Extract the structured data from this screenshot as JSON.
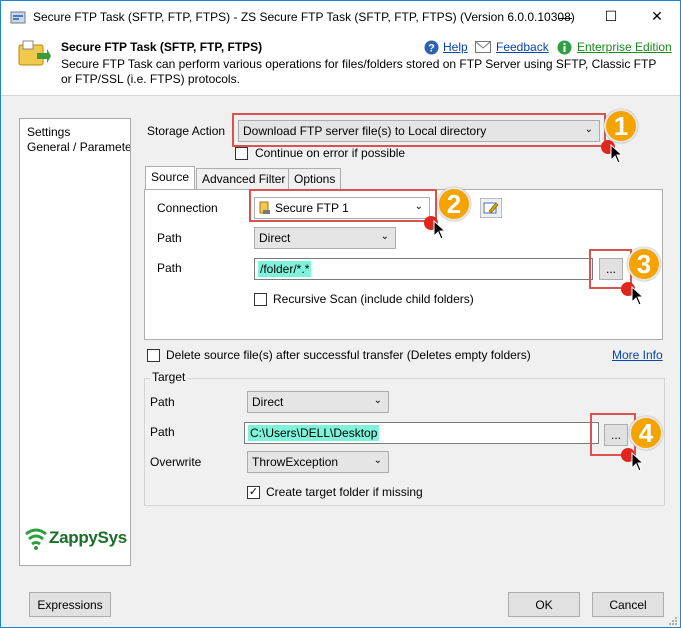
{
  "window": {
    "title": "Secure FTP Task (SFTP, FTP, FTPS) - ZS Secure FTP Task (SFTP, FTP, FTPS) (Version 6.0.0.10308)",
    "minimize": "—",
    "maximize": "☐",
    "close": "✕"
  },
  "header": {
    "title": "Secure FTP Task (SFTP, FTP, FTPS)",
    "description": "Secure FTP Task can perform various operations for files/folders stored on FTP Server using SFTP, Classic FTP or FTP/SSL (i.e. FTPS) protocols.",
    "help": "Help",
    "feedback": "Feedback",
    "edition": "Enterprise Edition"
  },
  "sidebar": {
    "items": [
      "Settings",
      "General / Parameters"
    ],
    "logo_text": "ZappySys"
  },
  "storage": {
    "label": "Storage Action",
    "value": "Download FTP server file(s) to Local directory",
    "continue_on_error": "Continue on error if possible"
  },
  "tabs": [
    "Source",
    "Advanced Filter",
    "Options"
  ],
  "source": {
    "connection_label": "Connection",
    "connection_value": "Secure FTP 1",
    "path_type_label": "Path",
    "path_type_value": "Direct",
    "path_label": "Path",
    "path_value": "/folder/*.*",
    "browse": "...",
    "recursive": "Recursive Scan (include child folders)"
  },
  "delete_source": "Delete source file(s) after successful transfer (Deletes empty folders)",
  "more_info": "More Info",
  "target": {
    "group_label": "Target",
    "path_type_label": "Path",
    "path_type_value": "Direct",
    "path_label": "Path",
    "path_value": "C:\\Users\\DELL\\Desktop",
    "browse": "...",
    "overwrite_label": "Overwrite",
    "overwrite_value": "ThrowException",
    "create_folder": "Create target folder if missing",
    "create_folder_checked": "✓"
  },
  "footer": {
    "expressions": "Expressions",
    "ok": "OK",
    "cancel": "Cancel"
  },
  "callouts": [
    "1",
    "2",
    "3",
    "4"
  ],
  "colors": {
    "accent": "#1e84d0",
    "callout": "#f5a300",
    "callout_box": "#d9534f",
    "highlight": "#7ff2dc",
    "link": "#0645ad"
  }
}
